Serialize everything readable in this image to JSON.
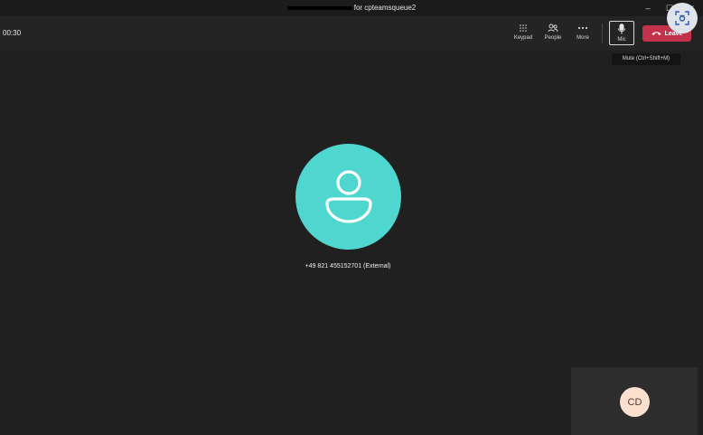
{
  "window": {
    "title_suffix": "for cpteamsqueue2",
    "controls": {
      "minimize": "–",
      "maximize": "☐",
      "close": "✕"
    }
  },
  "toolbar": {
    "timer": "00:30",
    "keypad_label": "Keypad",
    "people_label": "People",
    "more_label": "More",
    "mic_label": "Mic",
    "leave_label": "Leave",
    "mic_tooltip": "Mute (Ctrl+Shift+M)"
  },
  "stage": {
    "caller_label": "+49 821 455152701 (External)",
    "avatar_color": "#4fd6cf"
  },
  "self_view": {
    "initials": "CD"
  },
  "colors": {
    "background": "#202020",
    "leave": "#c4314b"
  }
}
